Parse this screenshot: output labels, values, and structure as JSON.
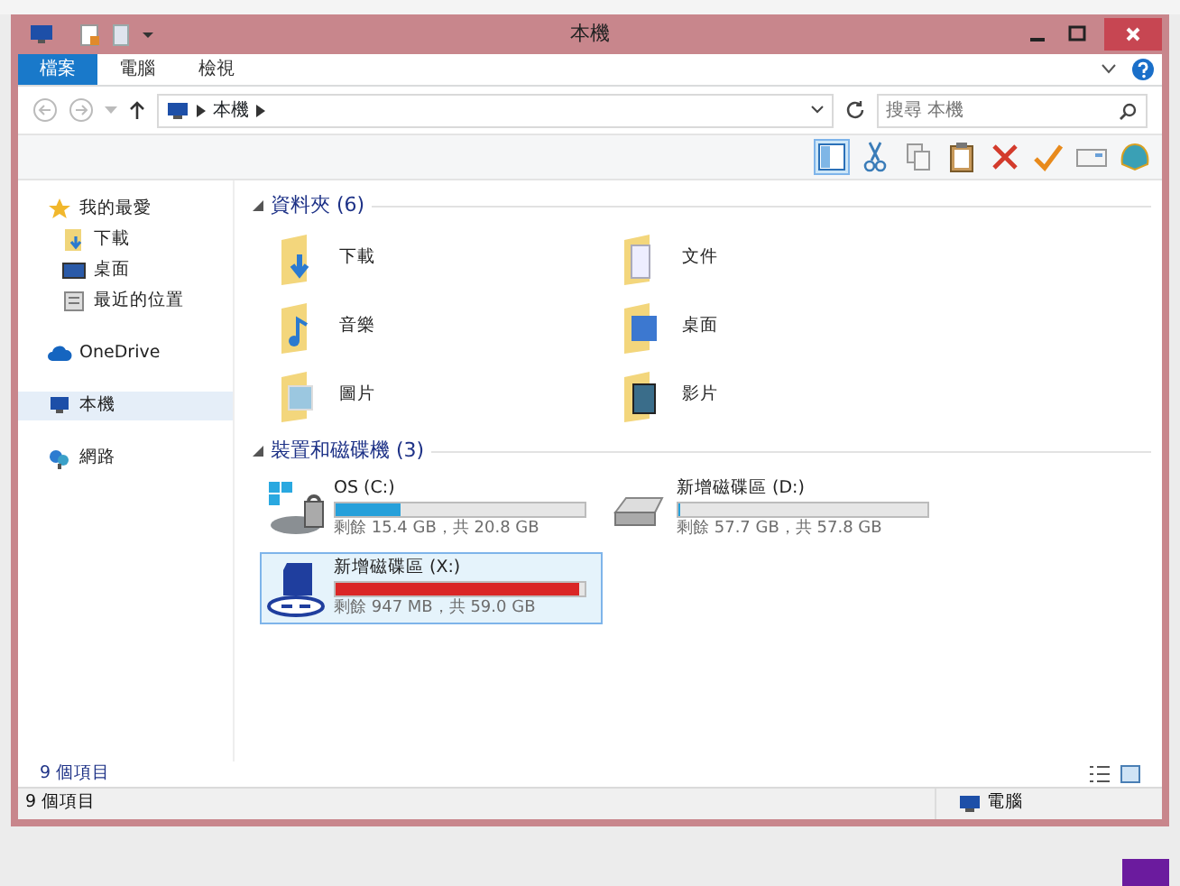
{
  "window": {
    "title": "本機"
  },
  "ribbon_tabs": [
    {
      "label": "檔案",
      "selected": true
    },
    {
      "label": "電腦",
      "selected": false
    },
    {
      "label": "檢視",
      "selected": false
    }
  ],
  "address_bar": {
    "path": [
      "本機"
    ]
  },
  "search": {
    "placeholder": "搜尋 本機"
  },
  "sidebar": {
    "items": [
      {
        "label": "我的最愛",
        "kind": "favorites",
        "selected": false,
        "children": [
          {
            "label": "下載",
            "kind": "downloads",
            "selected": false
          },
          {
            "label": "桌面",
            "kind": "desktop",
            "selected": false
          },
          {
            "label": "最近的位置",
            "kind": "recent",
            "selected": false
          }
        ]
      },
      {
        "label": "OneDrive",
        "kind": "cloud",
        "selected": false
      },
      {
        "label": "本機",
        "kind": "computer",
        "selected": true
      },
      {
        "label": "網路",
        "kind": "network",
        "selected": false
      }
    ]
  },
  "folders": {
    "heading": "資料夾 (6)",
    "items": [
      {
        "label": "下載",
        "kind": "downloads"
      },
      {
        "label": "文件",
        "kind": "documents"
      },
      {
        "label": "音樂",
        "kind": "music"
      },
      {
        "label": "桌面",
        "kind": "desktop"
      },
      {
        "label": "圖片",
        "kind": "pictures"
      },
      {
        "label": "影片",
        "kind": "videos"
      }
    ]
  },
  "drives": {
    "heading": "裝置和磁碟機 (3)",
    "items": [
      {
        "name": "OS (C:)",
        "kind": "system",
        "free": "剩餘 15.4 GB，共 20.8 GB",
        "level": 0.26,
        "color": "#26a0da",
        "selected": false
      },
      {
        "name": "新增磁碟區 (D:)",
        "kind": "disk",
        "free": "剩餘 57.7 GB，共 57.8 GB",
        "level": 0.01,
        "color": "#26a0da",
        "selected": false
      },
      {
        "name": "新增磁碟區 (X:)",
        "kind": "sd",
        "free": "剩餘 947 MB，共 59.0 GB",
        "level": 0.98,
        "color": "#da2626",
        "selected": true
      }
    ]
  },
  "item_count": "9 個項目",
  "status_bar": {
    "text": "9 個項目",
    "zone": "電腦"
  }
}
